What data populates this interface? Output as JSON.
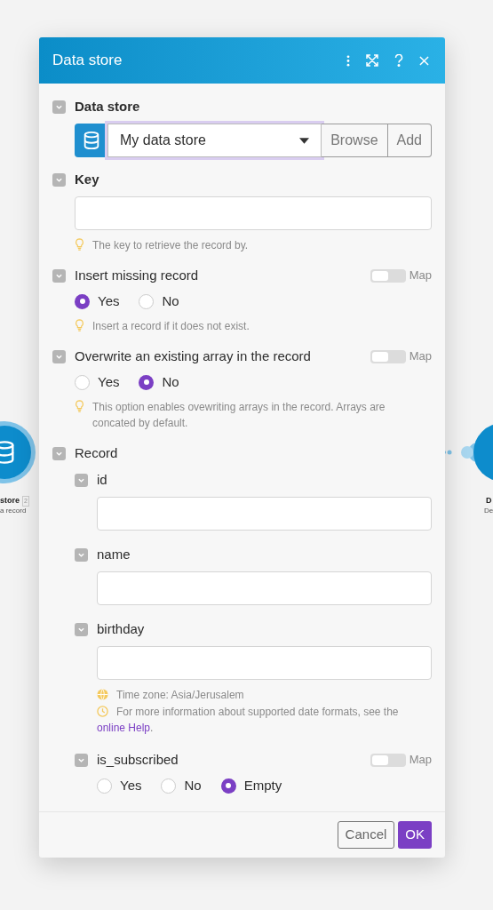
{
  "canvas": {
    "nodes": [
      {
        "kind": "source",
        "title": "store",
        "badge": "2",
        "subtitle": "a record"
      },
      {
        "kind": "target",
        "title": "D",
        "subtitle": "De"
      }
    ]
  },
  "dialog": {
    "title": "Data store",
    "fields": [
      {
        "kind": "select",
        "label": "Data store",
        "bold": true,
        "value": "My data store",
        "focused": true,
        "actions": [
          "Browse",
          "Add"
        ]
      },
      {
        "kind": "text",
        "label": "Key",
        "bold": true,
        "hints": [
          {
            "kind": "tip",
            "text": "The key to retrieve the record by."
          }
        ]
      },
      {
        "kind": "radio",
        "label": "Insert missing record",
        "bold": false,
        "map_on": false,
        "map_label": "Map",
        "options": [
          {
            "label": "Yes",
            "selected": true
          },
          {
            "label": "No",
            "selected": false
          }
        ],
        "hints": [
          {
            "kind": "tip",
            "text": "Insert a record if it does not exist."
          }
        ]
      },
      {
        "kind": "radio",
        "label": "Overwrite an existing array in the record",
        "bold": false,
        "map_on": false,
        "map_label": "Map",
        "options": [
          {
            "label": "Yes",
            "selected": false
          },
          {
            "label": "No",
            "selected": true
          }
        ],
        "hints": [
          {
            "kind": "tip",
            "text": "This option enables ovewriting arrays in the record. Arrays are concated by default."
          }
        ]
      },
      {
        "kind": "group",
        "label": "Record",
        "bold": false,
        "children": [
          {
            "kind": "text",
            "label": "id",
            "bold": false
          },
          {
            "kind": "text",
            "label": "name",
            "bold": false
          },
          {
            "kind": "text",
            "label": "birthday",
            "bold": false,
            "hints": [
              {
                "kind": "timezone",
                "text": "Time zone: Asia/Jerusalem"
              },
              {
                "kind": "info",
                "text": "For more information about supported date formats, see the",
                "link": "online Help",
                "after": "."
              }
            ]
          },
          {
            "kind": "radio",
            "label": "is_subscribed",
            "bold": false,
            "map_on": false,
            "map_label": "Map",
            "options": [
              {
                "label": "Yes",
                "selected": false
              },
              {
                "label": "No",
                "selected": false
              },
              {
                "label": "Empty",
                "selected": true
              }
            ]
          }
        ]
      }
    ],
    "buttons": [
      {
        "label": "Cancel",
        "kind": "secondary"
      },
      {
        "label": "OK",
        "kind": "primary"
      }
    ]
  }
}
